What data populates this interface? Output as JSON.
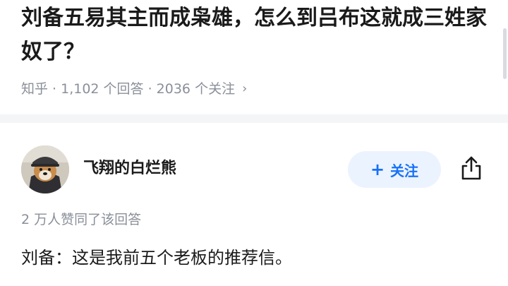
{
  "question": {
    "title": "刘备五易其主而成枭雄，怎么到吕布这就成三姓家奴了？",
    "meta": "知乎 · 1,102 个回答 · 2036 个关注",
    "meta_chevron": "›"
  },
  "answer": {
    "author_name": "飞翔的白烂熊",
    "follow_label": "关注",
    "follow_plus": "+",
    "upvote_summary": "2 万人赞同了该回答",
    "excerpt": "刘备：这是我前五个老板的推荐信。"
  },
  "icons": {
    "share": "share-icon",
    "avatar": "dog-avatar"
  },
  "colors": {
    "accent": "#1772f6",
    "follow_bg": "#ebf3ff",
    "meta_gray": "#8a8f99",
    "divider": "#f4f5f7"
  }
}
